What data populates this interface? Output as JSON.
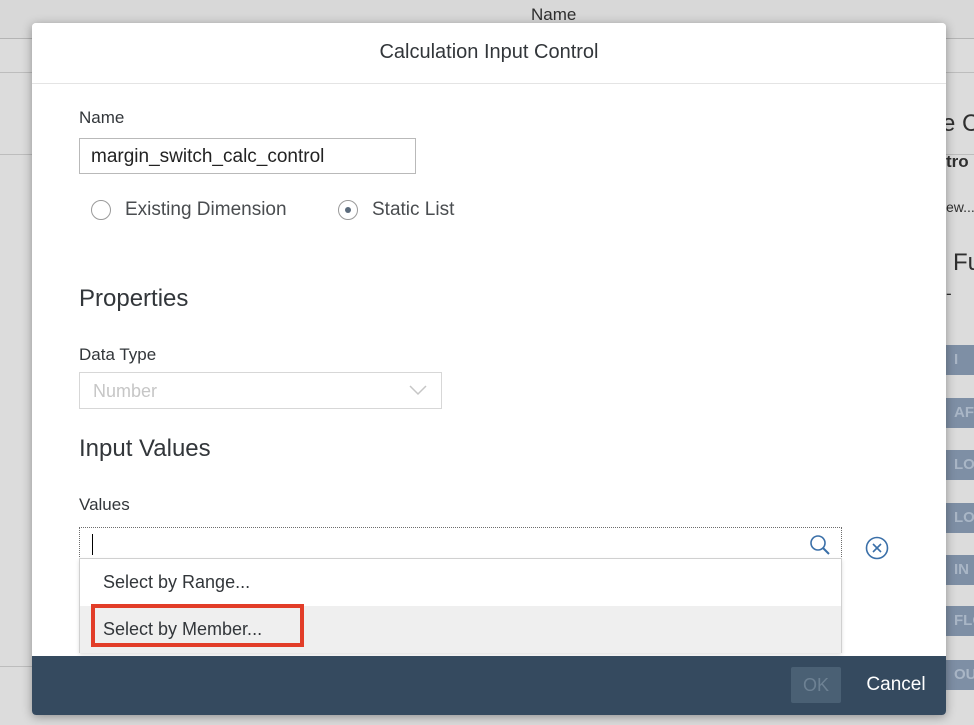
{
  "background": {
    "column_header": "Name",
    "right_panel_fragments": [
      "e C",
      "tro",
      "ew...",
      "Fu",
      "-"
    ],
    "function_chips": [
      "I",
      "AF",
      "LO",
      "LOC",
      "IN",
      "FLO",
      "OU"
    ]
  },
  "dialog": {
    "title": "Calculation Input Control",
    "name": {
      "label": "Name",
      "value": "margin_switch_calc_control"
    },
    "source_options": [
      {
        "label": "Existing Dimension",
        "selected": false
      },
      {
        "label": "Static List",
        "selected": true
      }
    ],
    "properties": {
      "heading": "Properties",
      "data_type_label": "Data Type",
      "data_type_value": "Number"
    },
    "input_values": {
      "heading": "Input Values",
      "values_label": "Values",
      "values_input": "",
      "menu_items": [
        "Select by Range...",
        "Select by Member..."
      ],
      "highlighted_item": "Select by Member..."
    },
    "footer": {
      "ok_label": "OK",
      "cancel_label": "Cancel"
    }
  },
  "colors": {
    "footer_bg": "#354a5f",
    "highlight_border": "#e23d28",
    "chip_bg": "#7e8fa5"
  }
}
